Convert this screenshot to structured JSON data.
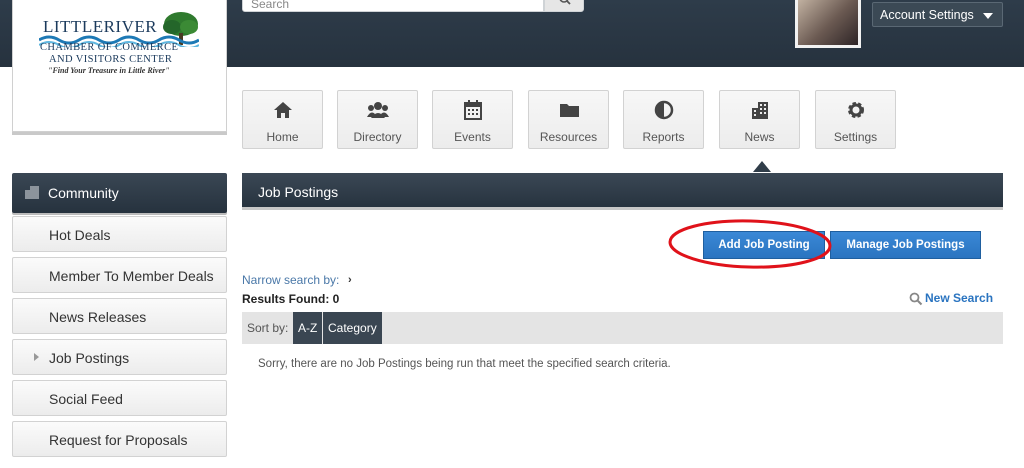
{
  "header": {
    "search": {
      "placeholder": "Search"
    },
    "account_label": "Account Settings"
  },
  "logo": {
    "title": "LITTLERIVER",
    "line1": "CHAMBER OF COMMERCE",
    "line2": "AND VISITORS CENTER",
    "tagline": "\"Find Your Treasure in Little River\""
  },
  "nav": {
    "tiles": [
      {
        "label": "Home",
        "icon": "home-icon"
      },
      {
        "label": "Directory",
        "icon": "people-icon"
      },
      {
        "label": "Events",
        "icon": "calendar-icon"
      },
      {
        "label": "Resources",
        "icon": "folder-icon"
      },
      {
        "label": "Reports",
        "icon": "pie-chart-icon"
      },
      {
        "label": "News",
        "icon": "building-icon"
      },
      {
        "label": "Settings",
        "icon": "gear-icon"
      }
    ],
    "active": "News"
  },
  "sidebar": {
    "heading": "Community",
    "items": [
      {
        "label": "Hot Deals"
      },
      {
        "label": "Member To Member Deals"
      },
      {
        "label": "News Releases"
      },
      {
        "label": "Job Postings",
        "current": true
      },
      {
        "label": "Social Feed"
      },
      {
        "label": "Request for Proposals"
      }
    ]
  },
  "main": {
    "title": "Job Postings",
    "add_button": "Add Job Posting",
    "manage_button": "Manage Job Postings",
    "narrow_label": "Narrow search by:",
    "results_label": "Results Found: 0",
    "new_search": "New Search",
    "sort_label": "Sort by:",
    "sort_options": [
      "A-Z",
      "Category"
    ],
    "empty_message": "Sorry, there are no Job Postings being run that meet the specified search criteria."
  },
  "colors": {
    "header_dark": "#2e3c4a",
    "button_blue": "#2a74c0",
    "annotation_red": "#e0121a"
  }
}
